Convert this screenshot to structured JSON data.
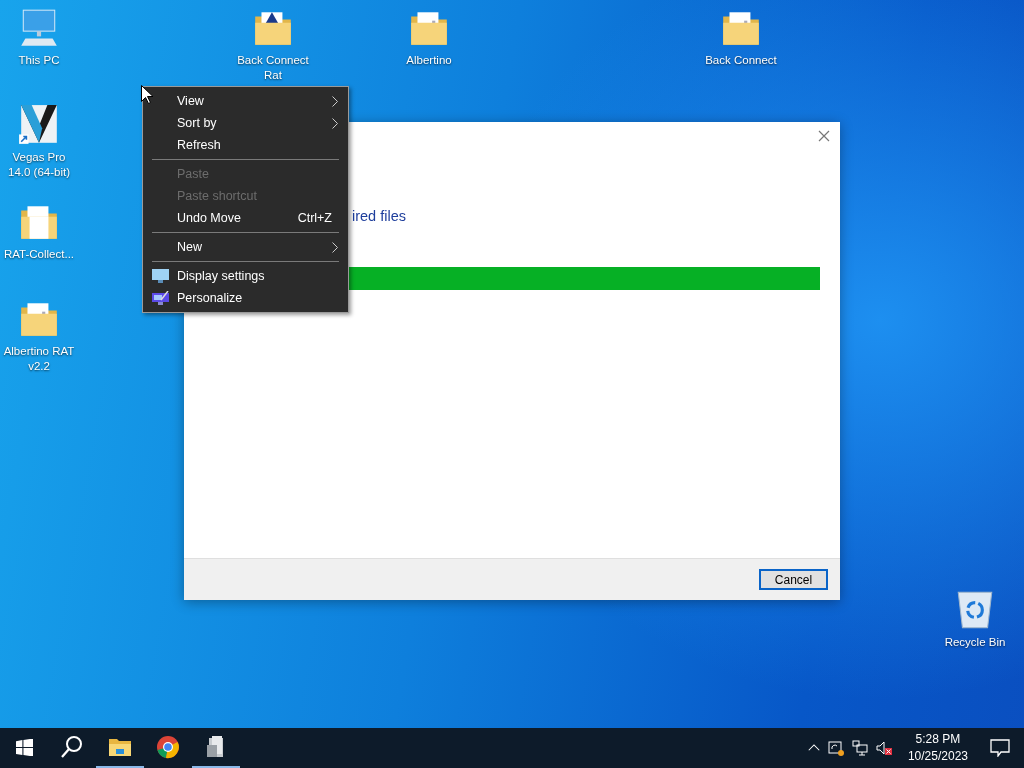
{
  "desktop_icons": [
    {
      "kind": "pc",
      "label": "This PC"
    },
    {
      "kind": "vegas",
      "label": "Vegas Pro 14.0 (64-bit)"
    },
    {
      "kind": "folder-doc",
      "label": "RAT-Collect..."
    },
    {
      "kind": "folder",
      "label": "Albertino RAT v2.2"
    },
    {
      "kind": "folder-img",
      "label": "Back Connect Rat"
    },
    {
      "kind": "folder",
      "label": "Albertino"
    },
    {
      "kind": "folder",
      "label": "Back Connect"
    },
    {
      "kind": "recycle",
      "label": "Recycle Bin"
    }
  ],
  "dialog": {
    "heading": "ired files",
    "progress": {
      "level": 1
    },
    "buttons": [
      "Cancel"
    ]
  },
  "context_menu": {
    "groups": [
      [
        {
          "label": "View",
          "disabled": false,
          "submenu": true
        },
        {
          "label": "Sort by",
          "disabled": false,
          "submenu": true
        },
        {
          "label": "Refresh",
          "disabled": false,
          "submenu": false
        }
      ],
      [
        {
          "label": "Paste",
          "disabled": true,
          "submenu": false
        },
        {
          "label": "Paste shortcut",
          "disabled": true,
          "submenu": false
        },
        {
          "label": "Undo Move",
          "disabled": false,
          "submenu": false,
          "shortcut": "Ctrl+Z"
        }
      ],
      [
        {
          "label": "New",
          "disabled": false,
          "submenu": true
        }
      ],
      [
        {
          "label": "Display settings",
          "disabled": false,
          "submenu": false,
          "kind": "display"
        },
        {
          "label": "Personalize",
          "disabled": false,
          "submenu": false,
          "kind": "personalize"
        }
      ]
    ]
  },
  "taskbar": {
    "apps": [
      {
        "kind": "explorer",
        "running": true
      },
      {
        "kind": "chrome",
        "running": false
      },
      {
        "kind": "installer",
        "running": true
      }
    ],
    "clock": {
      "time": "5:28 PM",
      "date": "10/25/2023"
    }
  }
}
